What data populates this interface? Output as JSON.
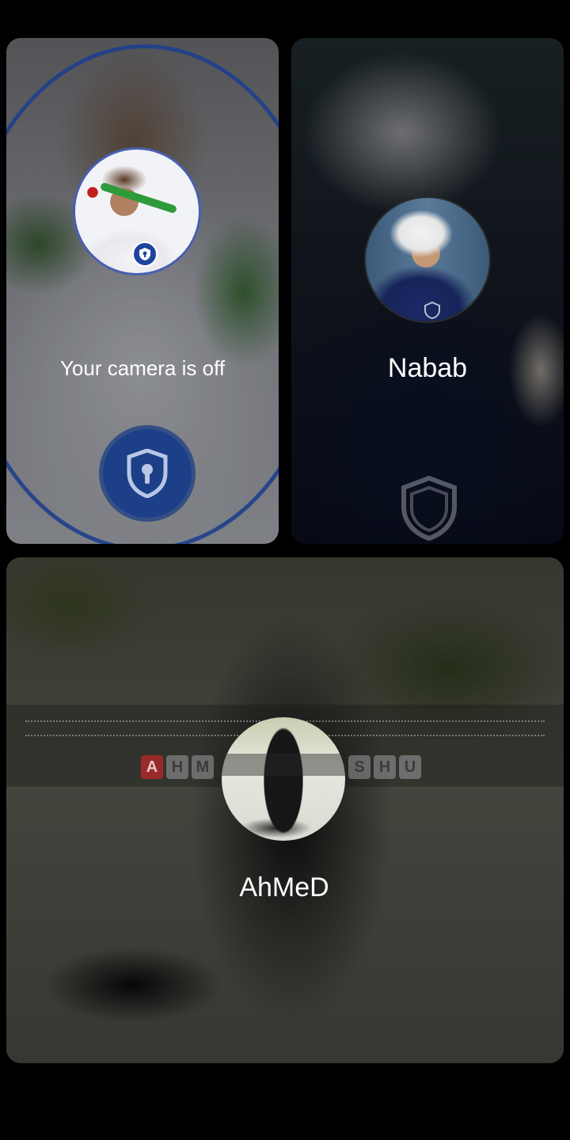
{
  "tiles": {
    "self": {
      "status_text": "Your camera is off",
      "avatar_icon": "user-avatar",
      "badge_icon": "shield-lock-icon"
    },
    "nabab": {
      "name": "Nabab",
      "avatar_icon": "user-avatar",
      "badge_icon": "shield-icon"
    },
    "ahmed": {
      "name": "AhMeD",
      "avatar_icon": "user-avatar"
    }
  },
  "colors": {
    "accent_blue": "#1e3f8c",
    "background": "#000000",
    "text": "#ffffff"
  }
}
